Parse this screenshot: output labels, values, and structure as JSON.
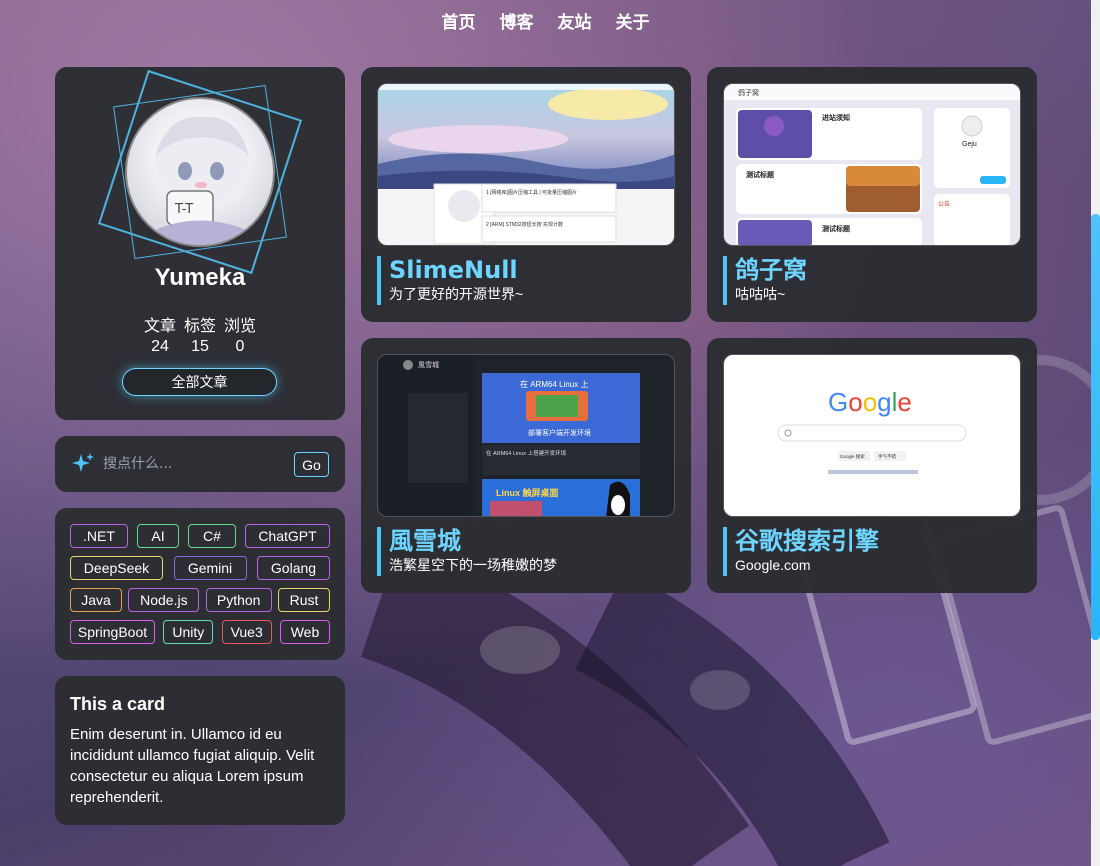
{
  "nav": [
    "首页",
    "博客",
    "友站",
    "关于"
  ],
  "profile": {
    "name": "Yumeka",
    "stats": [
      {
        "label": "文章",
        "value": "24"
      },
      {
        "label": "标签",
        "value": "15"
      },
      {
        "label": "浏览",
        "value": "0"
      }
    ],
    "all_button": "全部文章"
  },
  "search": {
    "placeholder": "搜点什么...",
    "go": "Go"
  },
  "tags": [
    [
      {
        "label": ".NET",
        "color": "#b565e8",
        "w": 58
      },
      {
        "label": "AI",
        "color": "#64d98a",
        "w": 42
      },
      {
        "label": "C#",
        "color": "#64d98a",
        "w": 48
      },
      {
        "label": "ChatGPT",
        "color": "#b565e8",
        "w": 85
      }
    ],
    [
      {
        "label": "DeepSeek",
        "color": "#e8d765",
        "w": 93
      },
      {
        "label": "Gemini",
        "color": "#7d6ee8",
        "w": 73
      },
      {
        "label": "Golang",
        "color": "#b565e8",
        "w": 73
      }
    ],
    [
      {
        "label": "Java",
        "color": "#e8a055",
        "w": 52
      },
      {
        "label": "Node.js",
        "color": "#b565e8",
        "w": 71
      },
      {
        "label": "Python",
        "color": "#b565e8",
        "w": 66
      },
      {
        "label": "Rust",
        "color": "#e8d765",
        "w": 52
      }
    ],
    [
      {
        "label": "SpringBoot",
        "color": "#d65ee8",
        "w": 85
      },
      {
        "label": "Unity",
        "color": "#64d9b5",
        "w": 50
      },
      {
        "label": "Vue3",
        "color": "#e85858",
        "w": 50
      },
      {
        "label": "Web",
        "color": "#d65ee8",
        "w": 50
      }
    ]
  ],
  "info": {
    "title": "This a card",
    "body": "Enim deserunt in. Ullamco id eu incididunt ullamco fugiat aliquip. Velit consectetur eu aliqua Lorem ipsum reprehenderit."
  },
  "sites": [
    {
      "title": "SlimeNull",
      "desc": "为了更好的开源世界~"
    },
    {
      "title": "鸽子窝",
      "desc": "咕咕咕~"
    },
    {
      "title": "風雪城",
      "desc": "浩繁星空下的一场稚嫩的梦"
    },
    {
      "title": "谷歌搜索引擎",
      "desc": "Google.com"
    }
  ],
  "screens": {
    "slimenull": {
      "line1": "1 [网络库]图片压缩工具 | 可批量压缩图片",
      "line2": "2 [ARM] STM32按钮长按 实现计数"
    },
    "gezi": {
      "logo": "鸽子窝",
      "c1": "进站须知",
      "c2": "测试标题",
      "c3": "测试标题",
      "profile": "Geju",
      "notice": "公告"
    },
    "fengxue": {
      "logo": "風雪城",
      "banner1": "在 ARM64 Linux 上",
      "banner2": "部署客户端开发环境",
      "post": "在 ARM64 Linux 上搭建开发环境",
      "banner3": "Linux 触屏桌面"
    },
    "google": {
      "logo": "Google",
      "btn1": "Google 搜索",
      "btn2": "手气不错"
    }
  }
}
